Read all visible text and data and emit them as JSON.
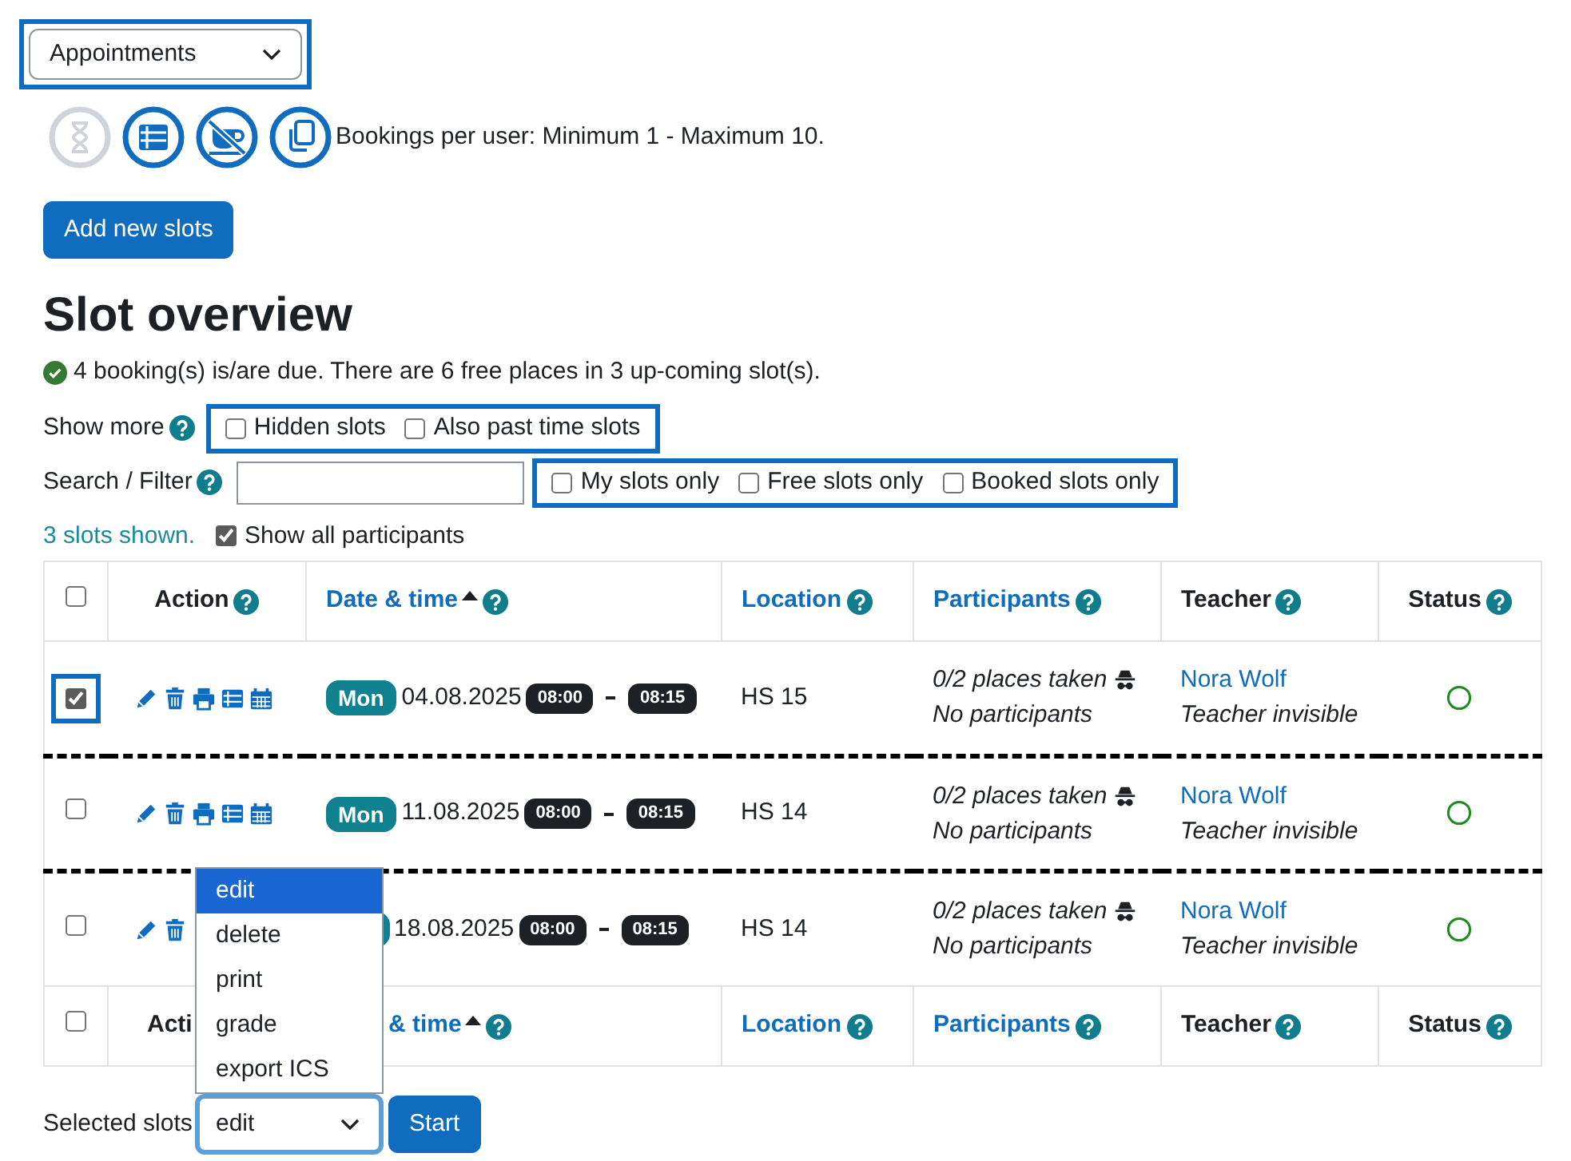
{
  "activity_select": {
    "value": "Appointments"
  },
  "tool_icons": [
    {
      "kind": "hourglass",
      "disabled": true
    },
    {
      "kind": "list",
      "disabled": false
    },
    {
      "kind": "no-cup",
      "disabled": false
    },
    {
      "kind": "copy",
      "disabled": false
    }
  ],
  "bookings_info": "Bookings per user: Minimum 1 - Maximum 10.",
  "add_button": "Add new slots",
  "heading": "Slot overview",
  "summary": "4 booking(s) is/are due. There are 6 free places in 3 up-coming slot(s).",
  "show_more": {
    "label": "Show more",
    "options": [
      {
        "label": "Hidden slots",
        "checked": false
      },
      {
        "label": "Also past time slots",
        "checked": false
      }
    ]
  },
  "filter": {
    "label": "Search / Filter",
    "options": [
      {
        "label": "My slots only",
        "checked": false
      },
      {
        "label": "Free slots only",
        "checked": false
      },
      {
        "label": "Booked slots only",
        "checked": false
      }
    ]
  },
  "slots_shown": "3 slots shown.",
  "show_all_participants": {
    "label": "Show all participants",
    "checked": true
  },
  "header": {
    "checked": false,
    "columns": [
      {
        "label": "Action",
        "link": false,
        "sorted": false
      },
      {
        "label": "Date & time",
        "link": true,
        "sorted": true
      },
      {
        "label": "Location",
        "link": true,
        "sorted": false
      },
      {
        "label": "Participants",
        "link": true,
        "sorted": false
      },
      {
        "label": "Teacher",
        "link": false,
        "sorted": false
      },
      {
        "label": "Status",
        "link": false,
        "sorted": false
      }
    ]
  },
  "rows": [
    {
      "checked": true,
      "actions": [
        {
          "kind": "edit"
        },
        {
          "kind": "delete"
        },
        {
          "kind": "print"
        },
        {
          "kind": "list"
        },
        {
          "kind": "calendar"
        }
      ],
      "day": "Mon",
      "date": "04.08.2025",
      "start": "08:00",
      "end": "08:15",
      "location": "HS 15",
      "places": "0/2 places taken",
      "participants": "No participants",
      "teacher": "Nora Wolf",
      "teacher_note": "Teacher invisible",
      "status": {
        "kind": "free"
      }
    },
    {
      "checked": false,
      "actions": [
        {
          "kind": "edit"
        },
        {
          "kind": "delete"
        },
        {
          "kind": "print"
        },
        {
          "kind": "list"
        },
        {
          "kind": "calendar"
        }
      ],
      "day": "Mon",
      "date": "11.08.2025",
      "start": "08:00",
      "end": "08:15",
      "location": "HS 14",
      "places": "0/2 places taken",
      "participants": "No participants",
      "teacher": "Nora Wolf",
      "teacher_note": "Teacher invisible",
      "status": {
        "kind": "free"
      }
    },
    {
      "checked": false,
      "actions": [
        {
          "kind": "edit"
        },
        {
          "kind": "delete"
        }
      ],
      "date": "18.08.2025",
      "start": "08:00",
      "end": "08:15",
      "location": "HS 14",
      "places": "0/2 places taken",
      "participants": "No participants",
      "teacher": "Nora Wolf",
      "teacher_note": "Teacher invisible",
      "status": {
        "kind": "free"
      }
    }
  ],
  "footer": {
    "checked": false,
    "columns": [
      {
        "label": "Acti",
        "link": false,
        "sorted": false
      },
      {
        "label": "& time",
        "link": true,
        "sorted": true
      },
      {
        "label": "Location",
        "link": true,
        "sorted": false
      },
      {
        "label": "Participants",
        "link": true,
        "sorted": false
      },
      {
        "label": "Teacher",
        "link": false,
        "sorted": false
      },
      {
        "label": "Status",
        "link": false,
        "sorted": false
      }
    ]
  },
  "selected_label": "Selected slots",
  "action_select": {
    "value": "edit",
    "open": true,
    "options": [
      {
        "label": "edit",
        "selected": true
      },
      {
        "label": "delete",
        "selected": false
      },
      {
        "label": "print",
        "selected": false
      },
      {
        "label": "grade",
        "selected": false
      },
      {
        "label": "export ICS",
        "selected": false
      }
    ]
  },
  "start_button": "Start"
}
